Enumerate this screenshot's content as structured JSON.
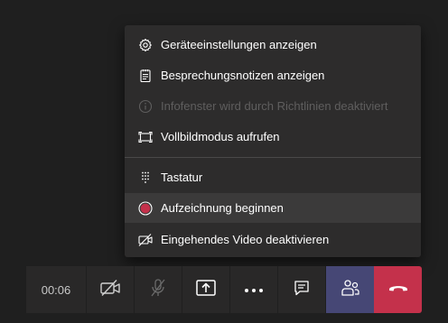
{
  "menu": {
    "items": [
      {
        "label": "Geräteeinstellungen anzeigen",
        "icon": "gear-icon"
      },
      {
        "label": "Besprechungsnotizen anzeigen",
        "icon": "notes-icon"
      },
      {
        "label": "Infofenster wird durch Richtlinien deaktiviert",
        "icon": "info-icon",
        "disabled": true
      },
      {
        "label": "Vollbildmodus aufrufen",
        "icon": "fullscreen-icon"
      },
      {
        "label": "Tastatur",
        "icon": "keypad-icon"
      },
      {
        "label": "Aufzeichnung beginnen",
        "icon": "record-icon"
      },
      {
        "label": "Eingehendes Video deaktivieren",
        "icon": "video-off-icon"
      }
    ]
  },
  "toolbar": {
    "timer": "00:06",
    "buttons": [
      "camera-off-icon",
      "mic-off-icon",
      "share-screen-icon",
      "more-icon",
      "chat-icon",
      "participants-icon",
      "hang-up-icon"
    ]
  },
  "colors": {
    "background": "#1f1f1f",
    "menu_bg": "#2d2c2c",
    "record": "#c4314b",
    "people_active": "#464775",
    "hangup": "#c4314b"
  }
}
